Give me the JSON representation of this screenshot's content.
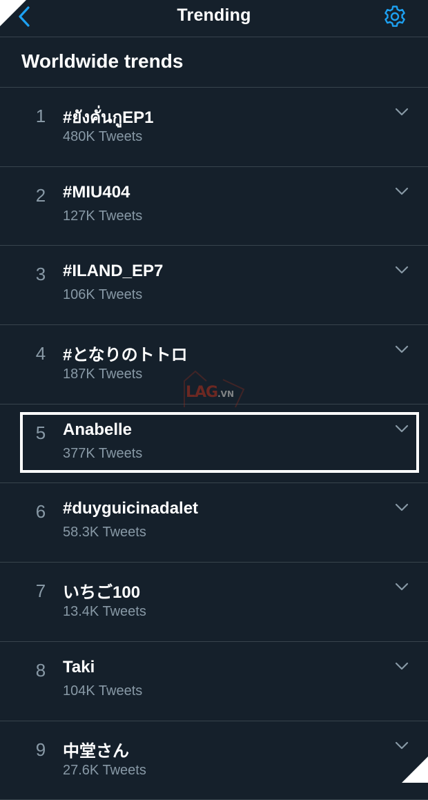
{
  "header": {
    "title": "Trending",
    "back_icon": "chevron-left-icon",
    "settings_icon": "gear-icon"
  },
  "section": {
    "title": "Worldwide trends"
  },
  "trends": [
    {
      "rank": "1",
      "name": "#ยังคั่นกูEP1",
      "count": "480K Tweets"
    },
    {
      "rank": "2",
      "name": "#MIU404",
      "count": "127K Tweets"
    },
    {
      "rank": "3",
      "name": "#ILAND_EP7",
      "count": "106K Tweets"
    },
    {
      "rank": "4",
      "name": "#となりのトトロ",
      "count": "187K Tweets"
    },
    {
      "rank": "5",
      "name": "Anabelle",
      "count": "377K Tweets"
    },
    {
      "rank": "6",
      "name": "#duyguicinadalet",
      "count": "58.3K Tweets"
    },
    {
      "rank": "7",
      "name": "いちご100",
      "count": "13.4K Tweets"
    },
    {
      "rank": "8",
      "name": "Taki",
      "count": "104K Tweets"
    },
    {
      "rank": "9",
      "name": "中堂さん",
      "count": "27.6K Tweets"
    }
  ],
  "watermark": {
    "text": "LAG",
    "suffix": ".VN"
  },
  "colors": {
    "background": "#15202b",
    "accent": "#1da1f2",
    "secondary_text": "#8899a6",
    "divider": "#38444d"
  }
}
